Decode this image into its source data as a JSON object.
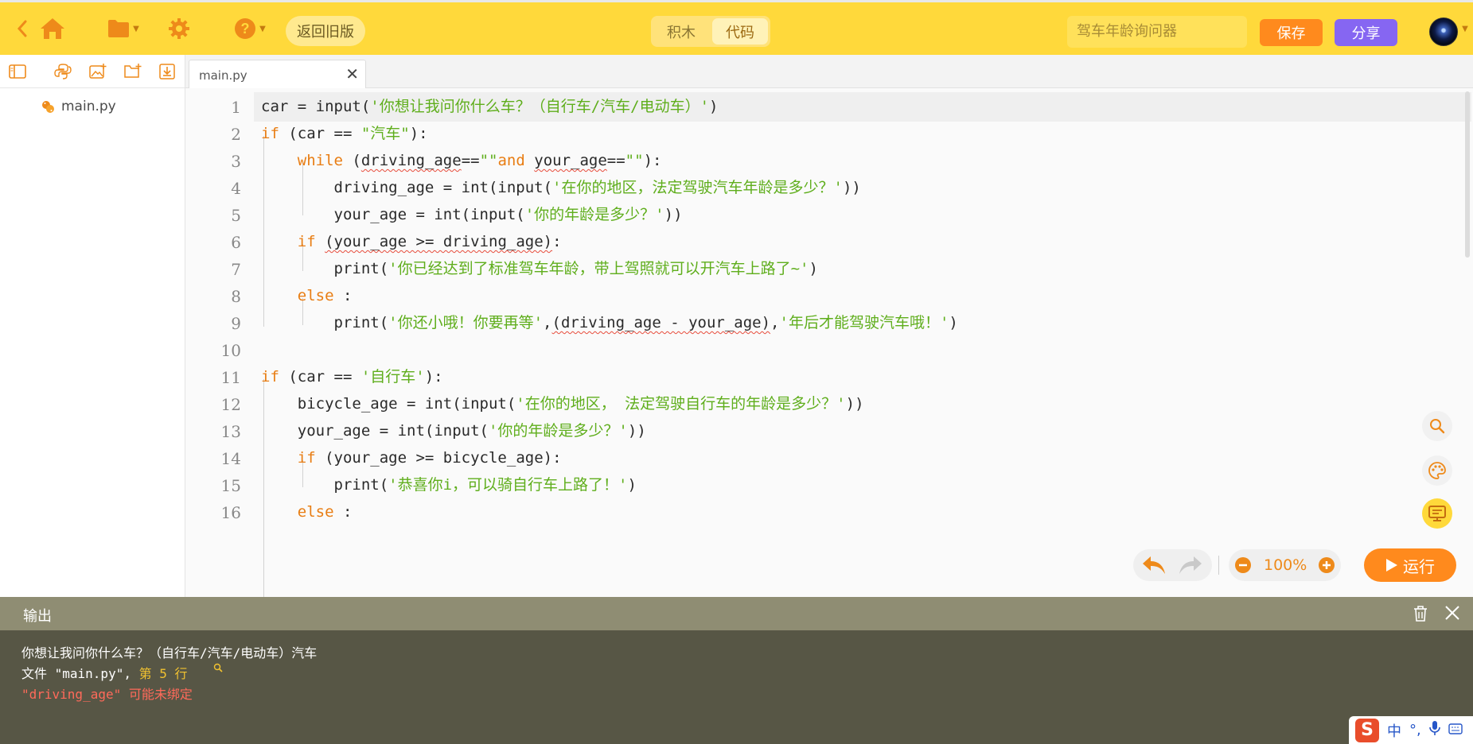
{
  "header": {
    "old_version_label": "返回旧版",
    "mode_tabs": [
      {
        "label": "积木",
        "active": false
      },
      {
        "label": "代码",
        "active": true
      }
    ],
    "project_title_placeholder": "驾车年龄询问器",
    "save_label": "保存",
    "share_label": "分享",
    "colors": {
      "bar": "#ffd93b",
      "accent": "#ff8a1d",
      "share": "#8666f2"
    }
  },
  "sidebar": {
    "tools": [
      "panel-toggle-icon",
      "python-file-icon",
      "image-icon",
      "new-folder-icon",
      "download-icon"
    ],
    "files": [
      {
        "name": "main.py"
      }
    ]
  },
  "editor": {
    "tab_label": "main.py",
    "line_numbers": [
      "1",
      "2",
      "3",
      "4",
      "5",
      "6",
      "7",
      "8",
      "9",
      "10",
      "11",
      "12",
      "13",
      "14",
      "15",
      "16"
    ]
  },
  "toolbar": {
    "zoom_label": "100%",
    "run_label": "运行"
  },
  "output": {
    "title": "输出",
    "lines": [
      "你想让我问你什么车？（自行车/汽车/电动车）汽车",
      "文件 \"main.py\", ",
      "第 5 行",
      "\"driving_age\" 可能未绑定"
    ],
    "colors": {
      "normal": "#ffffff",
      "link": "#f2c230",
      "error": "#ff6a5a"
    }
  },
  "ime": {
    "label": "中",
    "punct": "°,"
  }
}
